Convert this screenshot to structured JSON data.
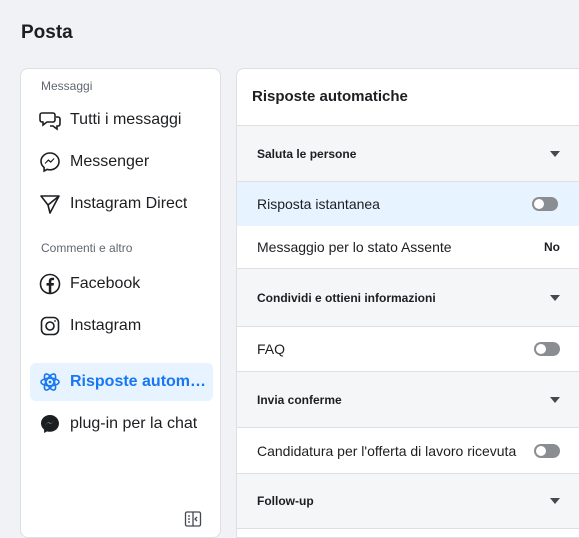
{
  "page": {
    "title": "Posta"
  },
  "sidebar": {
    "section_messages": "Messaggi",
    "section_comments": "Commenti e altro",
    "items": [
      {
        "label": "Tutti i messaggi",
        "icon": "chat-bubbles-icon"
      },
      {
        "label": "Messenger",
        "icon": "messenger-icon"
      },
      {
        "label": "Instagram Direct",
        "icon": "paper-plane-icon"
      },
      {
        "label": "Facebook",
        "icon": "facebook-icon"
      },
      {
        "label": "Instagram",
        "icon": "instagram-icon"
      },
      {
        "label": "Risposte autom…",
        "icon": "atom-icon",
        "active": true
      },
      {
        "label": "plug-in per la chat",
        "icon": "messenger-filled-icon"
      }
    ],
    "collapse_icon": "sidebar-toggle-icon"
  },
  "panel": {
    "title": "Risposte automatiche",
    "sections": [
      {
        "label": "Saluta le persone",
        "items": [
          {
            "label": "Risposta istantanea",
            "toggle": false,
            "selected": true
          },
          {
            "label": "Messaggio per lo stato Assente",
            "value": "No"
          }
        ]
      },
      {
        "label": "Condividi e ottieni informazioni",
        "items": [
          {
            "label": "FAQ",
            "toggle": false
          }
        ]
      },
      {
        "label": "Invia conferme",
        "items": [
          {
            "label": "Candidatura per l'offerta di lavoro ricevuta",
            "toggle": false
          }
        ]
      },
      {
        "label": "Follow-up",
        "items": []
      }
    ]
  },
  "colors": {
    "accent": "#1877f2",
    "active_bg": "#e7f3ff",
    "toggle_off": "#8a8d91"
  }
}
